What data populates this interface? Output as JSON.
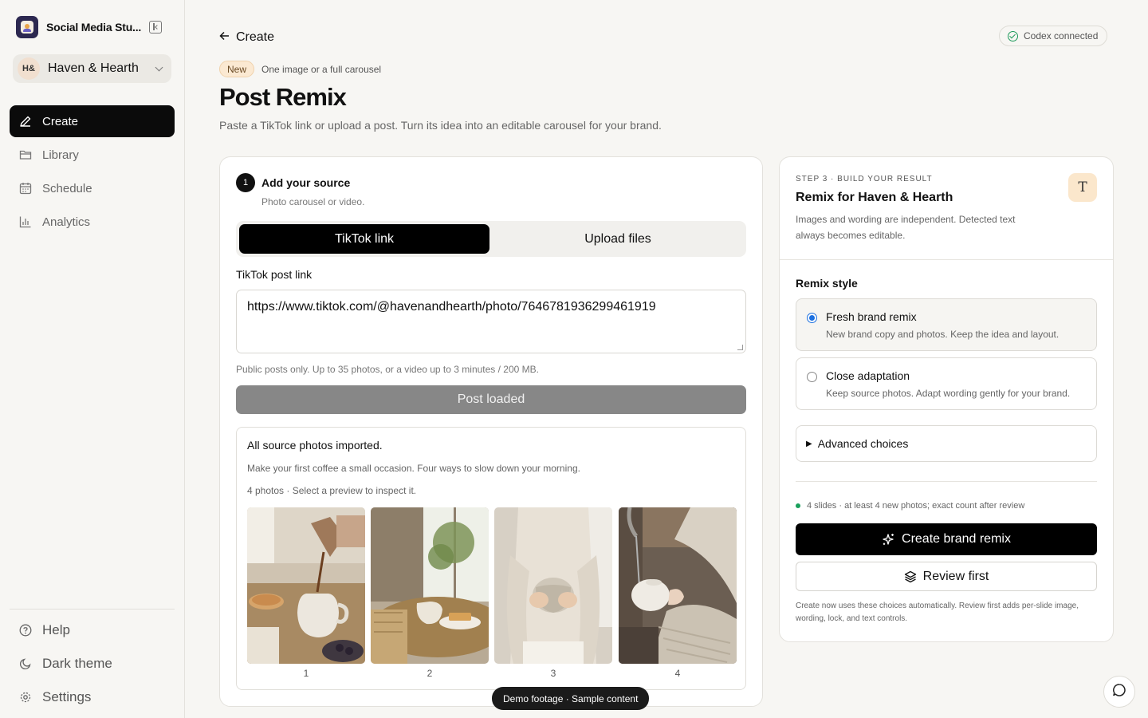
{
  "app": {
    "name": "Social Media Stu..."
  },
  "workspace": {
    "initials": "H&",
    "name": "Haven & Hearth"
  },
  "nav": [
    {
      "label": "Create",
      "icon": "pencil-icon",
      "active": true
    },
    {
      "label": "Library",
      "icon": "folder-icon"
    },
    {
      "label": "Schedule",
      "icon": "calendar-icon"
    },
    {
      "label": "Analytics",
      "icon": "bar-chart-icon"
    }
  ],
  "nav_bottom": [
    {
      "label": "Help",
      "icon": "help-circle-icon"
    },
    {
      "label": "Dark theme",
      "icon": "moon-icon"
    },
    {
      "label": "Settings",
      "icon": "gear-icon"
    }
  ],
  "header": {
    "back_label": "Create",
    "status": "Codex connected",
    "badge": "New",
    "badge_text": "One image or a full carousel",
    "title": "Post Remix",
    "subtitle": "Paste a TikTok link or upload a post. Turn its idea into an editable carousel for your brand."
  },
  "source": {
    "step": "1",
    "title": "Add your source",
    "subtitle": "Photo carousel or video.",
    "tabs": [
      "TikTok link",
      "Upload files"
    ],
    "field_label": "TikTok post link",
    "url": "https://www.tiktok.com/@havenandhearth/photo/7646781936299461919",
    "help": "Public posts only. Up to 35 photos, or a video up to 3 minutes / 200 MB.",
    "loaded_button": "Post loaded"
  },
  "imported": {
    "title": "All source photos imported.",
    "caption": "Make your first coffee a small occasion. Four ways to slow down your morning.",
    "count": "4 photos · Select a preview to inspect it.",
    "photos": [
      "1",
      "2",
      "3",
      "4"
    ]
  },
  "demo_pill": "Demo footage · Sample content",
  "result": {
    "kicker": "STEP 3 · BUILD YOUR RESULT",
    "title": "Remix for Haven & Hearth",
    "desc": "Images and wording are independent. Detected text always becomes editable.",
    "icon_letter": "T",
    "style_label": "Remix style",
    "options": [
      {
        "title": "Fresh brand remix",
        "desc": "New brand copy and photos. Keep the idea and layout.",
        "selected": true
      },
      {
        "title": "Close adaptation",
        "desc": "Keep source photos. Adapt wording gently for your brand.",
        "selected": false
      }
    ],
    "advanced": "Advanced choices",
    "slides_note": "4 slides · at least 4 new photos; exact count after review",
    "create_button": "Create brand remix",
    "review_button": "Review first",
    "footnote": "Create now uses these choices automatically. Review first adds per-slide image, wording, lock, and text controls."
  },
  "colors": {
    "accent": "#000000",
    "radio": "#1a6fe0",
    "status_green": "#1c9a5a",
    "badge_bg": "#fbe9d2"
  }
}
